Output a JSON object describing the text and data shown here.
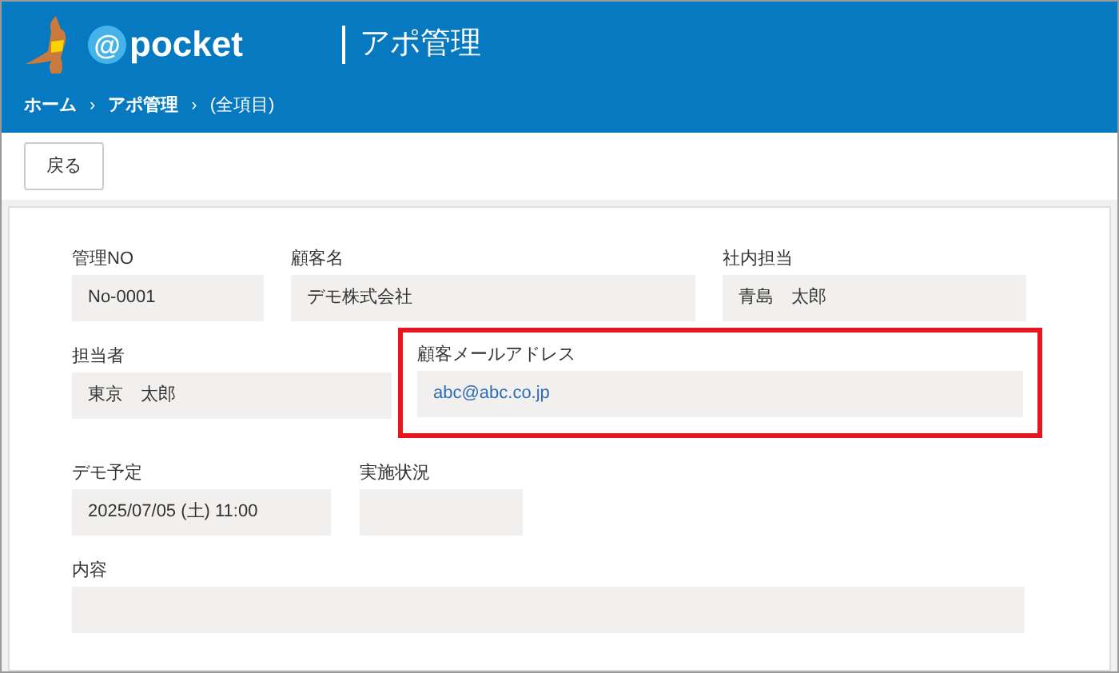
{
  "header": {
    "logo": {
      "at": "@",
      "word": "pocket"
    },
    "title": "アポ管理"
  },
  "breadcrumb": [
    {
      "label": "ホーム",
      "link": true
    },
    {
      "separator": "›",
      "label": "アポ管理",
      "link": true
    },
    {
      "separator": "›",
      "label": "(全項目)",
      "link": false
    }
  ],
  "toolbar": {
    "buttons": [
      "戻る"
    ]
  },
  "form": {
    "rows": [
      [
        {
          "label": "管理NO",
          "value": "No-0001",
          "kind": "text",
          "highlighted": false
        },
        {
          "label": "顧客名",
          "value": "デモ株式会社",
          "kind": "text",
          "highlighted": false
        },
        {
          "label": "社内担当",
          "value": "青島　太郎",
          "kind": "text",
          "highlighted": false
        }
      ],
      [
        {
          "label": "担当者",
          "value": "東京　太郎",
          "kind": "text",
          "highlighted": false
        },
        {
          "label": "顧客メールアドレス",
          "value": "abc@abc.co.jp",
          "kind": "link",
          "highlighted": true
        }
      ],
      [
        {
          "label": "デモ予定",
          "value": "2025/07/05 (土) 11:00",
          "kind": "text",
          "highlighted": false
        },
        {
          "label": "実施状況",
          "highlighted": false
        }
      ],
      [
        {
          "label": "内容",
          "highlighted": false
        }
      ]
    ]
  }
}
